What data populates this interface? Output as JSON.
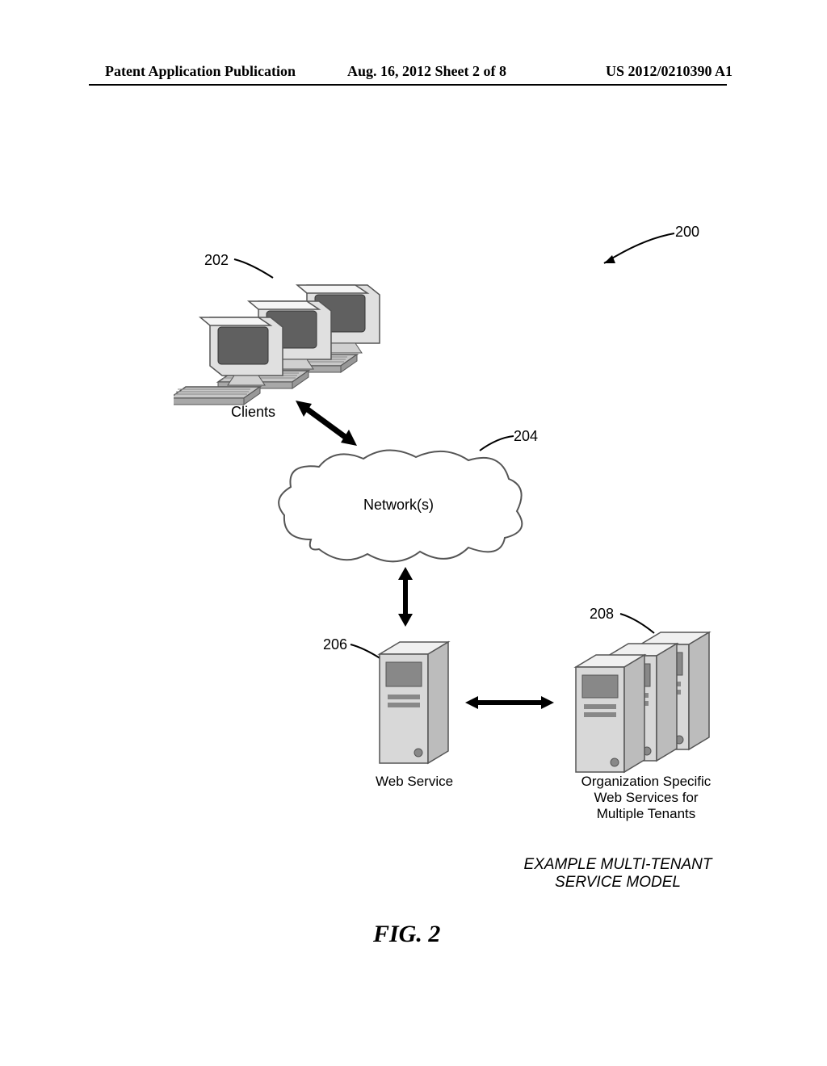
{
  "header": {
    "left": "Patent Application Publication",
    "mid": "Aug. 16, 2012  Sheet 2 of 8",
    "right": "US 2012/0210390 A1"
  },
  "refs": {
    "r200": "200",
    "r202": "202",
    "r204": "204",
    "r206": "206",
    "r208": "208"
  },
  "labels": {
    "clients": "Clients",
    "networks": "Network(s)",
    "webservice": "Web Service",
    "orgservices_l1": "Organization Specific",
    "orgservices_l2": "Web Services for",
    "orgservices_l3": "Multiple Tenants"
  },
  "caption": {
    "l1": "EXAMPLE MULTI-TENANT",
    "l2": "SERVICE MODEL"
  },
  "figure": "FIG. 2"
}
